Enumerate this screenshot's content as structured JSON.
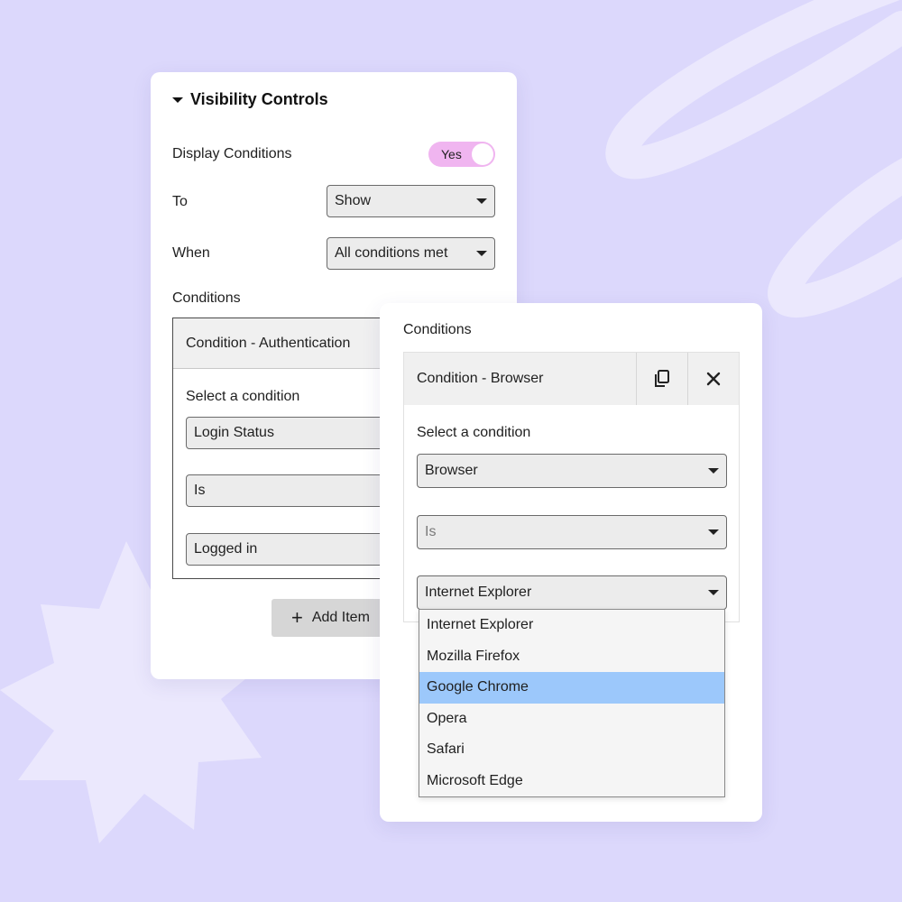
{
  "visibility_panel": {
    "section_title": "Visibility Controls",
    "display_conditions_label": "Display Conditions",
    "display_conditions_toggle": "Yes",
    "to_label": "To",
    "to_value": "Show",
    "when_label": "When",
    "when_value": "All conditions met",
    "conditions_label": "Conditions",
    "condition_title": "Condition - Authentication",
    "select_condition_label": "Select a condition",
    "field_1": "Login Status",
    "field_2": "Is",
    "field_3": "Logged in",
    "add_item_label": "Add Item"
  },
  "conditions_panel": {
    "conditions_label": "Conditions",
    "condition_title": "Condition - Browser",
    "select_condition_label": "Select a condition",
    "field_1": "Browser",
    "field_2": "Is",
    "field_3": "Internet Explorer",
    "duplicate_icon": "copy-icon",
    "close_icon": "close-icon",
    "dropdown_options": [
      "Internet Explorer",
      "Mozilla Firefox",
      "Google Chrome",
      "Opera",
      "Safari",
      "Microsoft Edge"
    ],
    "highlighted_option": "Google Chrome"
  },
  "colors": {
    "background": "#dcd8fc",
    "decor": "#ebe8fd",
    "toggle_on": "#f0b5f0",
    "option_highlight": "#9cc8fb"
  }
}
